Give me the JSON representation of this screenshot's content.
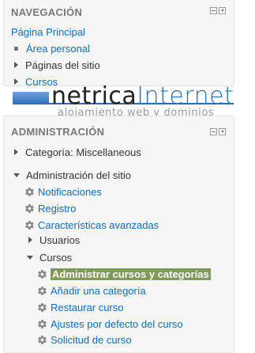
{
  "nav_block": {
    "title": "NAVEGACIÓN",
    "home_link": "Página Principal",
    "items": [
      {
        "label": "Área personal"
      },
      {
        "label": "Páginas del sitio"
      },
      {
        "label": "Cursos"
      }
    ]
  },
  "watermark": {
    "name_part1": "netrica",
    "name_part2": "Internet",
    "tagline": "alojamiento web y dominios"
  },
  "admin_block": {
    "title": "ADMINISTRACIÓN",
    "category": "Categoría: Miscellaneous",
    "site_admin": "Administración del sitio",
    "site_items": [
      {
        "label": "Notificaciones"
      },
      {
        "label": "Registro"
      },
      {
        "label": "Características avanzadas"
      }
    ],
    "users": "Usuarios",
    "courses": "Cursos",
    "course_items": [
      {
        "label": "Administrar cursos y categorías"
      },
      {
        "label": "Añadir una categoría"
      },
      {
        "label": "Restaurar curso"
      },
      {
        "label": "Ajustes por defecto del curso"
      },
      {
        "label": "Solicitud de curso"
      }
    ]
  },
  "colors": {
    "link": "#0f6cbf",
    "highlight": "#7e9a55",
    "logo_blue": "#2e6fb8"
  },
  "icons": [
    "hide-block-icon",
    "dock-block-icon",
    "triangle-right-icon",
    "triangle-down-icon",
    "gear-icon",
    "bullet-icon"
  ]
}
